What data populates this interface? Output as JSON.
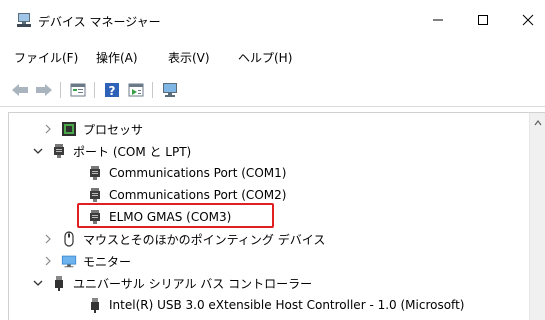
{
  "window": {
    "title": "デバイス マネージャー",
    "minimize_icon": "minimize-icon",
    "maximize_icon": "maximize-icon",
    "close_icon": "close-icon"
  },
  "menu": {
    "file": "ファイル(F)",
    "action": "操作(A)",
    "view": "表示(V)",
    "help": "ヘルプ(H)"
  },
  "toolbar": {
    "buttons": [
      "back-arrow-icon",
      "forward-arrow-icon",
      "properties-icon",
      "help-icon",
      "update-driver-icon",
      "monitor-icon"
    ]
  },
  "tree": {
    "processor": "プロセッサ",
    "ports": "ポート (COM と LPT)",
    "port1": "Communications Port (COM1)",
    "port2": "Communications Port (COM2)",
    "port3": "ELMO GMAS (COM3)",
    "mouse": "マウスとそのほかのポインティング デバイス",
    "monitor": "モニター",
    "usb": "ユニバーサル シリアル バス コントローラー",
    "usb1": "Intel(R) USB 3.0 eXtensible Host Controller - 1.0 (Microsoft)"
  },
  "colors": {
    "highlight_border": "#e02020",
    "accent": "#0078d7"
  }
}
